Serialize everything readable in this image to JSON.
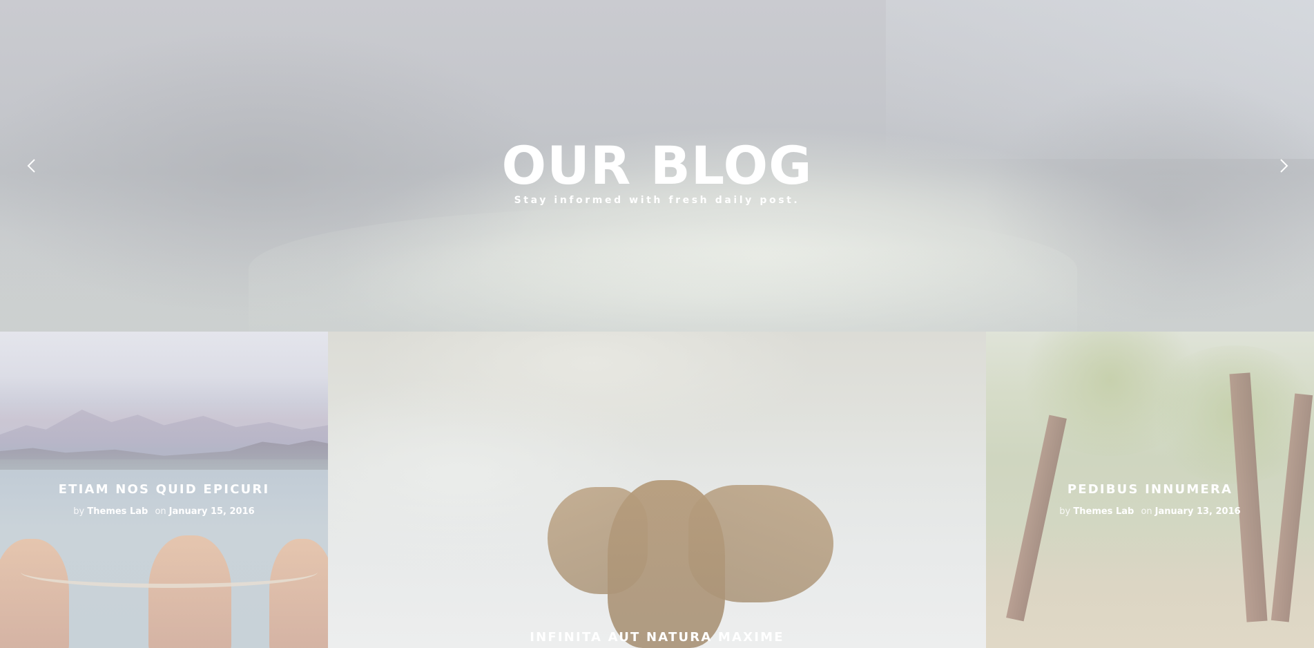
{
  "hero": {
    "title": "OUR BLOG",
    "subtitle": "Stay informed with fresh daily post.",
    "prev_icon": "chevron-left-icon",
    "next_icon": "chevron-right-icon"
  },
  "posts": [
    {
      "title": "ETIAM NOS QUID EPICURI",
      "by_label": "by",
      "author": "Themes Lab",
      "on_label": "on",
      "date": "January 15, 2016"
    },
    {
      "title": "INFINITA AUT NATURA MAXIME"
    },
    {
      "title": "PEDIBUS INNUMERA",
      "by_label": "by",
      "author": "Themes Lab",
      "on_label": "on",
      "date": "January 13, 2016"
    }
  ],
  "colors": {
    "text": "#ffffff",
    "hero_tint": "#c8cacf"
  }
}
